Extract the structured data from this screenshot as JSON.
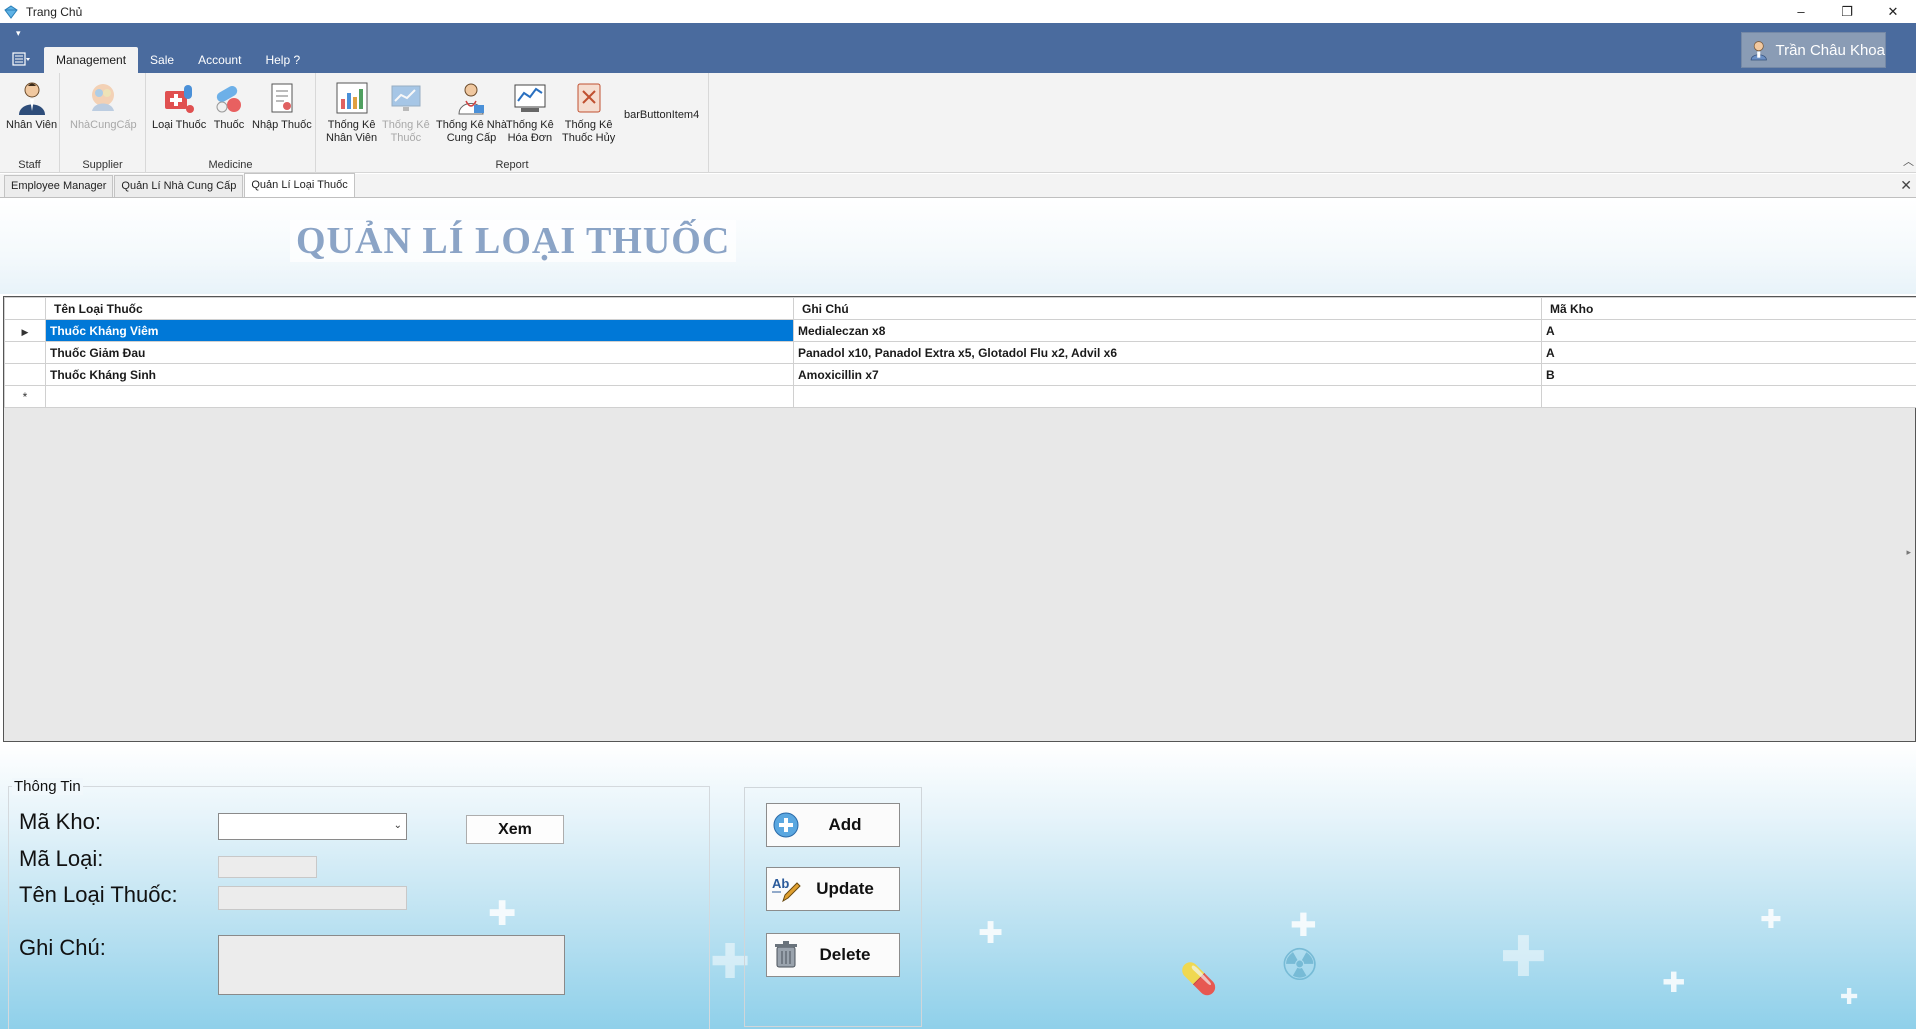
{
  "window": {
    "title": "Trang Chủ",
    "minimize_glyph": "–",
    "restore_glyph": "❐",
    "close_glyph": "✕"
  },
  "ribbon": {
    "tabs": [
      {
        "label": "Management"
      },
      {
        "label": "Sale"
      },
      {
        "label": "Account"
      },
      {
        "label": "Help ?"
      }
    ],
    "user_name": "Trần Châu Khoa",
    "groups": {
      "staff": "Staff",
      "supplier": "Supplier",
      "medicine": "Medicine",
      "report": "Report"
    },
    "buttons": {
      "nhan_vien": "Nhân Viên",
      "nha_cung_cap": "NhàCungCấp",
      "loai_thuoc": "Loại Thuốc",
      "thuoc": "Thuốc",
      "nhap_thuoc": "Nhập Thuốc",
      "tk_nhan_vien_1": "Thống Kê",
      "tk_nhan_vien_2": "Nhân Viên",
      "tk_thuoc_1": "Thống Kê",
      "tk_thuoc_2": "Thuốc",
      "tk_ncc_1": "Thống Kê Nhà",
      "tk_ncc_2": "Cung Cấp",
      "tk_hoa_don_1": "Thống Kê",
      "tk_hoa_don_2": "Hóa Đơn",
      "tk_thuoc_huy_1": "Thống Kê",
      "tk_thuoc_huy_2": "Thuốc Hủy",
      "bar_item4": "barButtonItem4"
    }
  },
  "doc_tabs": [
    {
      "label": "Employee Manager"
    },
    {
      "label": "Quản Lí Nhà Cung Cấp"
    },
    {
      "label": "Quản Lí Loại Thuốc"
    }
  ],
  "page": {
    "title": "QUẢN LÍ LOẠI THUỐC"
  },
  "grid": {
    "columns": [
      "Tên Loại Thuốc",
      "Ghi Chú",
      "Mã Kho"
    ],
    "rows": [
      {
        "ten": "Thuốc Kháng Viêm",
        "ghichu": "Medialeczan x8",
        "makho": "A"
      },
      {
        "ten": "Thuốc Giảm Đau",
        "ghichu": "Panadol x10, Panadol Extra x5, Glotadol Flu x2, Advil x6",
        "makho": "A"
      },
      {
        "ten": "Thuốc Kháng Sinh",
        "ghichu": "Amoxicillin x7",
        "makho": "B"
      }
    ],
    "current_row_marker": "▶",
    "new_row_marker": "*"
  },
  "form": {
    "legend": "Thông Tin",
    "ma_kho_label": "Mã Kho:",
    "ma_loai_label": "Mã Loại:",
    "ten_loai_label": "Tên Loại Thuốc:",
    "ghi_chu_label": "Ghi Chú:",
    "xem_button": "Xem",
    "ma_kho_value": "",
    "ma_loai_value": "",
    "ten_loai_value": "",
    "ghi_chu_value": ""
  },
  "actions": {
    "add": "Add",
    "update": "Update",
    "delete": "Delete"
  },
  "colors": {
    "ribbon_band": "#4a6b9e",
    "selection": "#0078d7",
    "title": "#8ba4c6"
  }
}
